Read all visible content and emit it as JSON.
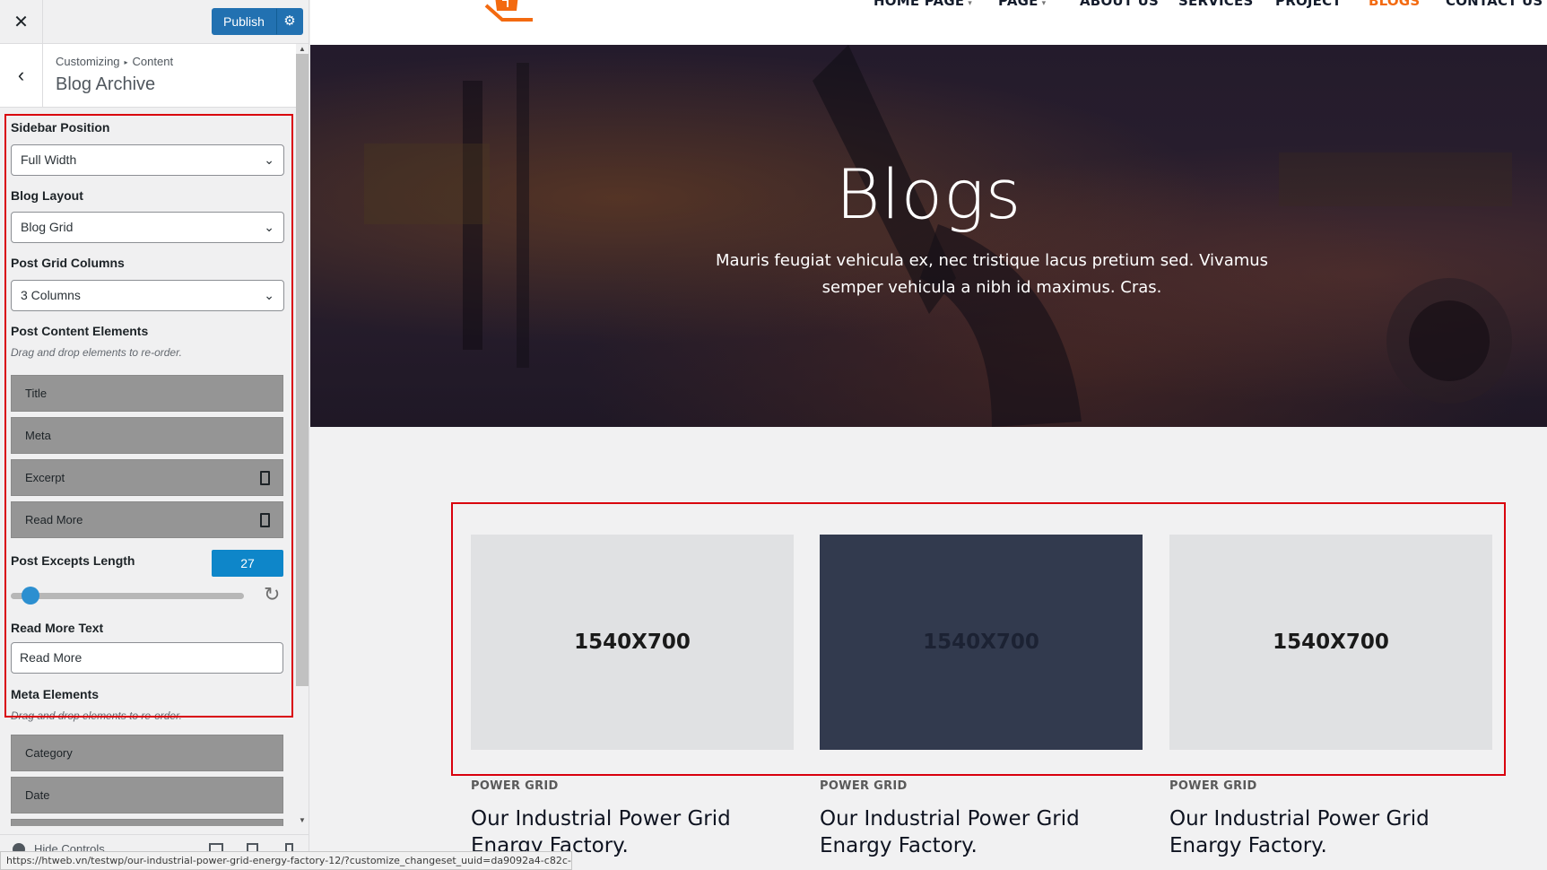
{
  "customizer": {
    "close_icon": "close-icon",
    "publish_label": "Publish",
    "settings_icon": "gear-icon",
    "breadcrumb": {
      "root": "Customizing",
      "section": "Content"
    },
    "section_title": "Blog Archive",
    "sidebar_position": {
      "label": "Sidebar Position",
      "value": "Full Width"
    },
    "blog_layout": {
      "label": "Blog Layout",
      "value": "Blog Grid"
    },
    "grid_columns": {
      "label": "Post Grid Columns",
      "value": "3 Columns"
    },
    "content_elements": {
      "label": "Post Content Elements",
      "description": "Drag and drop elements to re-order.",
      "items": [
        "Title",
        "Meta",
        "Excerpt",
        "Read More"
      ]
    },
    "excerpt_length": {
      "label": "Post Excepts Length",
      "value": "27",
      "fraction": 0.05
    },
    "read_more_text": {
      "label": "Read More Text",
      "value": "Read More"
    },
    "meta_elements": {
      "label": "Meta Elements",
      "description": "Drag and drop elements to re-order.",
      "items": [
        "Category",
        "Date"
      ]
    },
    "hide_controls": "Hide Controls"
  },
  "status_url": "https://htweb.vn/testwp/our-industrial-power-grid-energy-factory-12/?customize_changeset_uuid=da9092a4-c82c-4...",
  "site": {
    "nav": [
      {
        "label": "HOME PAGE",
        "has_dropdown": true
      },
      {
        "label": "PAGE",
        "has_dropdown": true
      },
      {
        "label": "ABOUT US",
        "has_dropdown": false
      },
      {
        "label": "SERVICES",
        "has_dropdown": false
      },
      {
        "label": "PROJECT",
        "has_dropdown": false
      },
      {
        "label": "BLOGS",
        "has_dropdown": false,
        "active": true
      },
      {
        "label": "CONTACT US",
        "has_dropdown": false
      }
    ],
    "hero": {
      "title": "Blogs",
      "subtitle": "Mauris feugiat vehicula ex, nec tristique lacus pretium sed. Vivamus semper vehicula a nibh id maximus. Cras."
    },
    "posts": [
      {
        "image_label": "1540X700",
        "category": "POWER GRID",
        "title": "Our Industrial Power Grid Enargy Factory."
      },
      {
        "image_label": "1540X700",
        "category": "POWER GRID",
        "title": "Our Industrial Power Grid Enargy Factory."
      },
      {
        "image_label": "1540X700",
        "category": "POWER GRID",
        "title": "Our Industrial Power Grid Enargy Factory."
      }
    ]
  },
  "colors": {
    "accent": "#2271b1",
    "active_nav": "#f36a10",
    "highlight": "#d9000d"
  }
}
